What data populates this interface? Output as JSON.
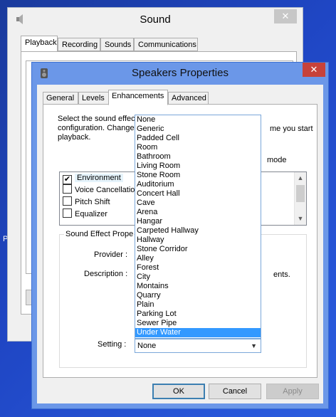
{
  "desktop": {
    "fragment_text": "P"
  },
  "sound_window": {
    "title": "Sound",
    "close_label": "✕",
    "tabs": [
      "Playback",
      "Recording",
      "Sounds",
      "Communications"
    ]
  },
  "speakers_window": {
    "title": "Speakers Properties",
    "close_label": "✕",
    "tabs": [
      "General",
      "Levels",
      "Enhancements",
      "Advanced"
    ],
    "active_tab": "Enhancements",
    "description_left": [
      "Select the sound effect",
      "configuration. Changes",
      "playback."
    ],
    "description_right": "me you start",
    "mode_text": "mode",
    "effects": [
      {
        "label": "Environment",
        "checked": true,
        "check_mark": "✔"
      },
      {
        "label": "Voice Cancellation",
        "checked": false,
        "check_mark": ""
      },
      {
        "label": "Pitch Shift",
        "checked": false,
        "check_mark": ""
      },
      {
        "label": "Equalizer",
        "checked": false,
        "check_mark": ""
      }
    ],
    "properties_group_title": "Sound Effect Properties",
    "provider_label": "Provider :",
    "description_label": "Description :",
    "description_fragment": "ents.",
    "setting_label": "Setting :",
    "setting_value": "None",
    "setting_options": [
      "None",
      "Generic",
      "Padded Cell",
      "Room",
      "Bathroom",
      "Living Room",
      "Stone Room",
      "Auditorium",
      "Concert Hall",
      "Cave",
      "Arena",
      "Hangar",
      "Carpeted Hallway",
      "Hallway",
      "Stone Corridor",
      "Alley",
      "Forest",
      "City",
      "Montains",
      "Quarry",
      "Plain",
      "Parking Lot",
      "Sewer Pipe",
      "Under Water"
    ],
    "highlighted_option": "Under Water",
    "buttons": {
      "ok": "OK",
      "cancel": "Cancel",
      "apply": "Apply"
    }
  },
  "colors": {
    "selection": "#3399ff",
    "title_bar_active": "#6b97e8",
    "close_button": "#c7423a"
  }
}
